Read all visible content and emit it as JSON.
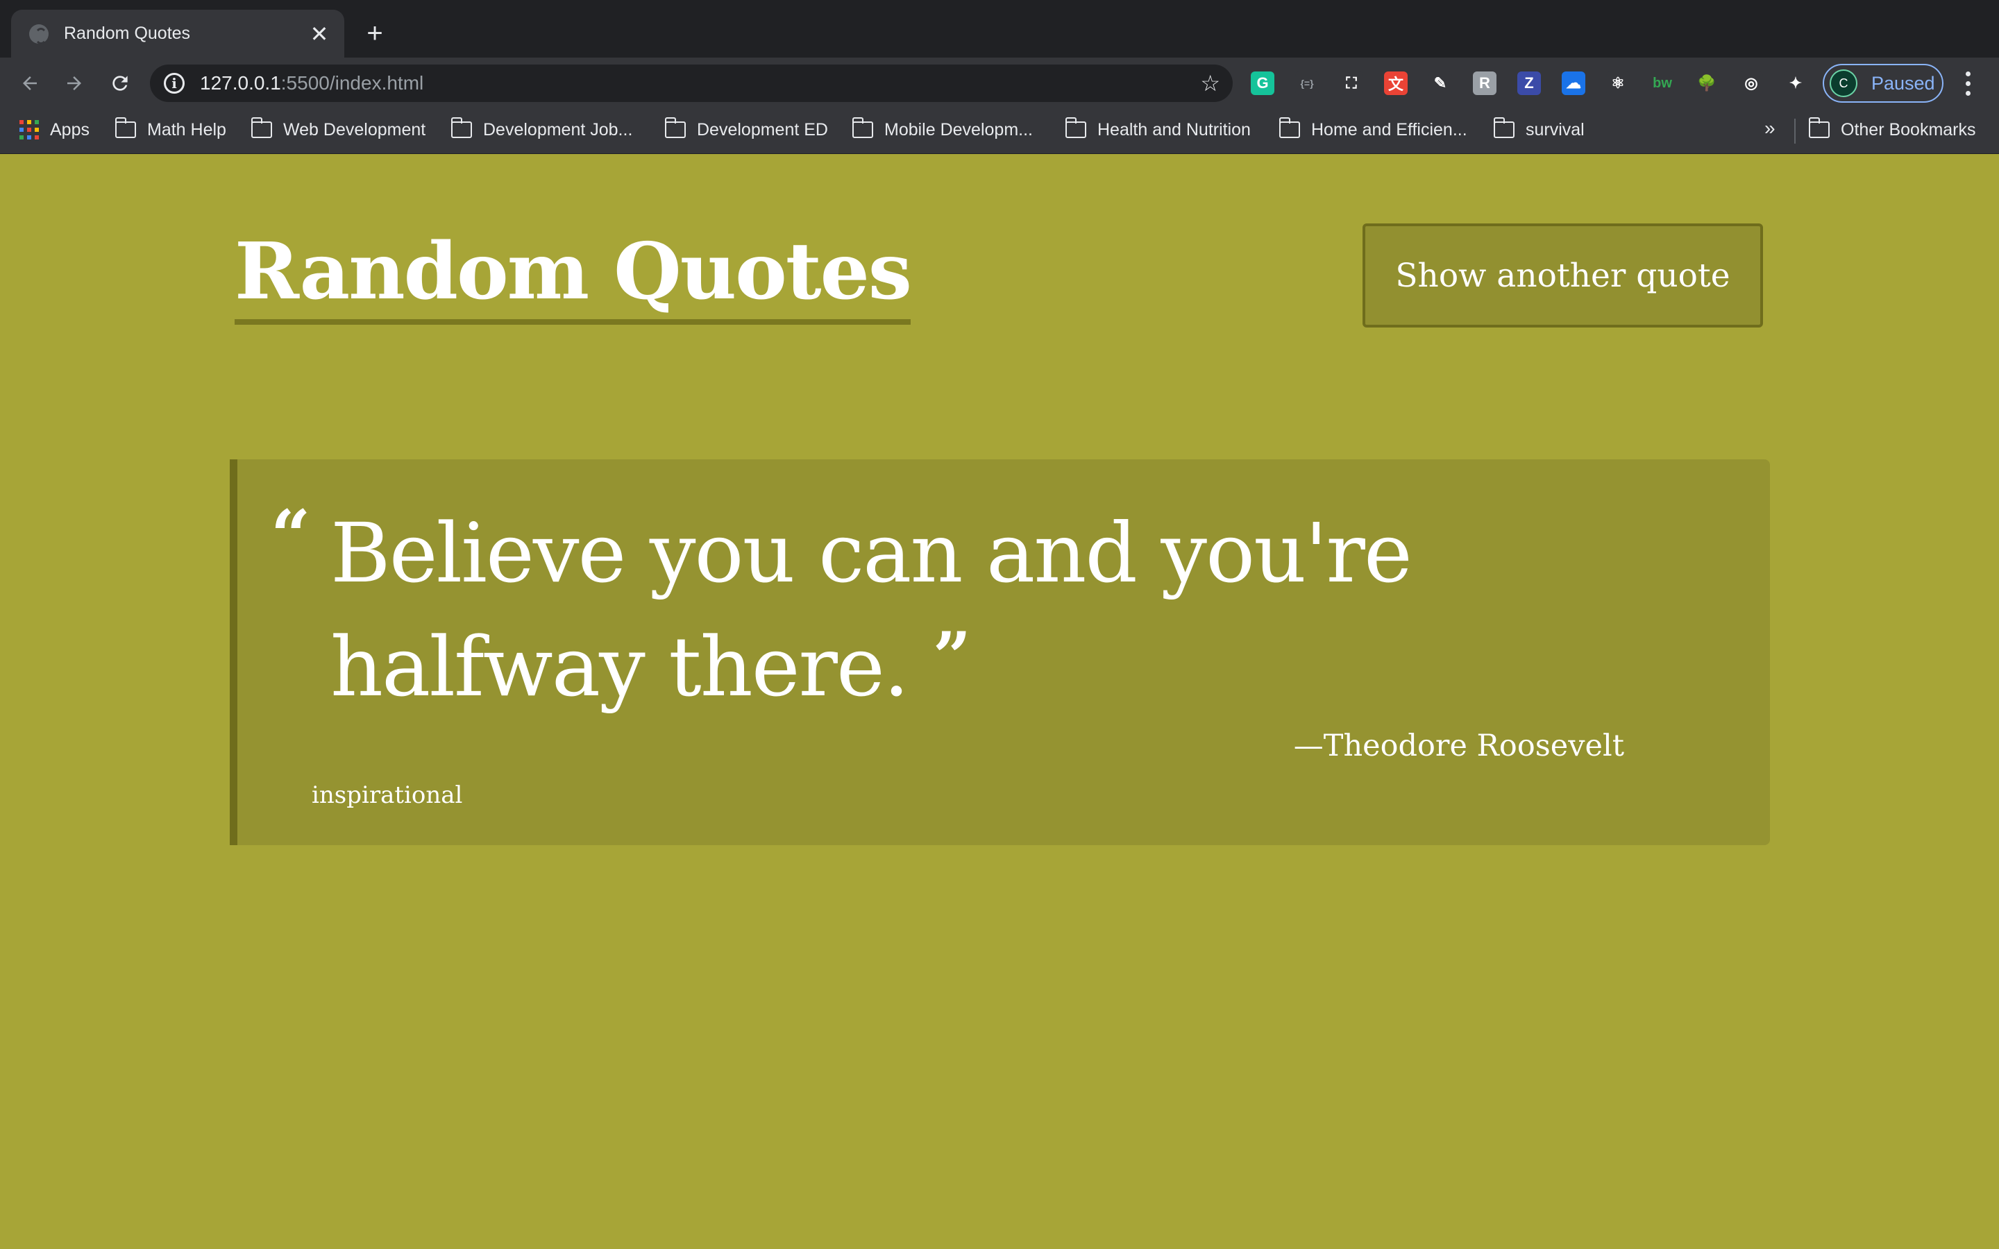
{
  "browser": {
    "tab": {
      "title": "Random Quotes",
      "close_glyph": "✕",
      "favicon": "globe-icon"
    },
    "new_tab_glyph": "+",
    "omnibox": {
      "host": "127.0.0.1",
      "rest": ":5500/index.html",
      "info_glyph": "i",
      "star_glyph": "☆"
    },
    "extensions": [
      {
        "name": "grammarly-extension-icon",
        "glyph": "G",
        "color": "#15c39a"
      },
      {
        "name": "json-viewer-extension-icon",
        "glyph": "{=}",
        "color": "#35363a"
      },
      {
        "name": "screenshot-extension-icon",
        "glyph": "⛶",
        "color": "#35363a"
      },
      {
        "name": "translate-extension-icon",
        "glyph": "文",
        "color": "#ea4335"
      },
      {
        "name": "color-picker-extension-icon",
        "glyph": "✎",
        "color": "#35363a"
      },
      {
        "name": "gray-extension-icon",
        "glyph": "R",
        "color": "#9aa0a6"
      },
      {
        "name": "zotero-extension-icon",
        "glyph": "Z",
        "color": "#3b4ba8"
      },
      {
        "name": "cloud-extension-icon",
        "glyph": "☁",
        "color": "#1a73e8"
      },
      {
        "name": "react-devtools-extension-icon",
        "glyph": "⚛",
        "color": "#35363a"
      },
      {
        "name": "bw-extension-icon",
        "glyph": "bw",
        "color": "#35363a"
      },
      {
        "name": "tree-extension-icon",
        "glyph": "🌳",
        "color": "#35363a"
      },
      {
        "name": "aperture-extension-icon",
        "glyph": "◎",
        "color": "#35363a"
      },
      {
        "name": "puzzle-extensions-icon",
        "glyph": "✦",
        "color": "#35363a"
      }
    ],
    "profile": {
      "initial": "C",
      "label": "Paused"
    },
    "bookmarks": {
      "apps_label": "Apps",
      "folders": [
        "Math Help",
        "Web Development",
        "Development Job...",
        "Development ED",
        "Mobile Developm...",
        "Health and Nutrition",
        "Home and Efficien...",
        "survival"
      ],
      "more_glyph": "»",
      "other_label": "Other Bookmarks"
    }
  },
  "page": {
    "title": "Random Quotes",
    "button_label": "Show another quote",
    "quote": {
      "open_mark": "“",
      "text": "Believe you can and you're halfway there.",
      "close_mark": "”",
      "author": "—Theodore Roosevelt",
      "tag": "inspirational"
    }
  },
  "colors": {
    "page_background": "#a7a537",
    "card_background": "#959331",
    "accent_border": "#6f6d1c",
    "text": "#ffffff"
  }
}
